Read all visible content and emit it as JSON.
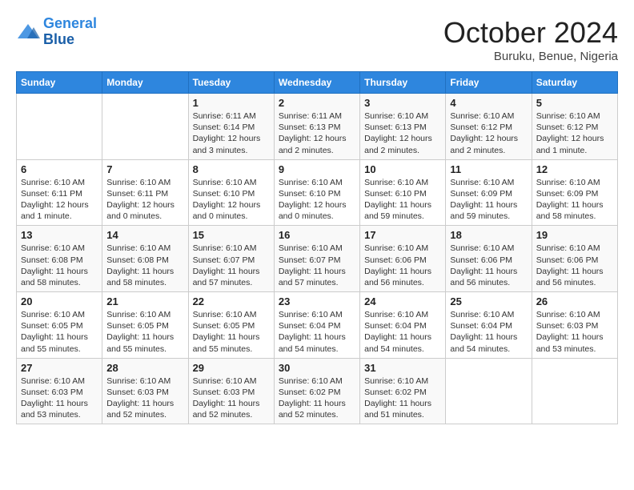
{
  "header": {
    "logo_line1": "General",
    "logo_line2": "Blue",
    "month": "October 2024",
    "location": "Buruku, Benue, Nigeria"
  },
  "weekdays": [
    "Sunday",
    "Monday",
    "Tuesday",
    "Wednesday",
    "Thursday",
    "Friday",
    "Saturday"
  ],
  "weeks": [
    [
      {
        "day": "",
        "info": ""
      },
      {
        "day": "",
        "info": ""
      },
      {
        "day": "1",
        "info": "Sunrise: 6:11 AM\nSunset: 6:14 PM\nDaylight: 12 hours\nand 3 minutes."
      },
      {
        "day": "2",
        "info": "Sunrise: 6:11 AM\nSunset: 6:13 PM\nDaylight: 12 hours\nand 2 minutes."
      },
      {
        "day": "3",
        "info": "Sunrise: 6:10 AM\nSunset: 6:13 PM\nDaylight: 12 hours\nand 2 minutes."
      },
      {
        "day": "4",
        "info": "Sunrise: 6:10 AM\nSunset: 6:12 PM\nDaylight: 12 hours\nand 2 minutes."
      },
      {
        "day": "5",
        "info": "Sunrise: 6:10 AM\nSunset: 6:12 PM\nDaylight: 12 hours\nand 1 minute."
      }
    ],
    [
      {
        "day": "6",
        "info": "Sunrise: 6:10 AM\nSunset: 6:11 PM\nDaylight: 12 hours\nand 1 minute."
      },
      {
        "day": "7",
        "info": "Sunrise: 6:10 AM\nSunset: 6:11 PM\nDaylight: 12 hours\nand 0 minutes."
      },
      {
        "day": "8",
        "info": "Sunrise: 6:10 AM\nSunset: 6:10 PM\nDaylight: 12 hours\nand 0 minutes."
      },
      {
        "day": "9",
        "info": "Sunrise: 6:10 AM\nSunset: 6:10 PM\nDaylight: 12 hours\nand 0 minutes."
      },
      {
        "day": "10",
        "info": "Sunrise: 6:10 AM\nSunset: 6:10 PM\nDaylight: 11 hours\nand 59 minutes."
      },
      {
        "day": "11",
        "info": "Sunrise: 6:10 AM\nSunset: 6:09 PM\nDaylight: 11 hours\nand 59 minutes."
      },
      {
        "day": "12",
        "info": "Sunrise: 6:10 AM\nSunset: 6:09 PM\nDaylight: 11 hours\nand 58 minutes."
      }
    ],
    [
      {
        "day": "13",
        "info": "Sunrise: 6:10 AM\nSunset: 6:08 PM\nDaylight: 11 hours\nand 58 minutes."
      },
      {
        "day": "14",
        "info": "Sunrise: 6:10 AM\nSunset: 6:08 PM\nDaylight: 11 hours\nand 58 minutes."
      },
      {
        "day": "15",
        "info": "Sunrise: 6:10 AM\nSunset: 6:07 PM\nDaylight: 11 hours\nand 57 minutes."
      },
      {
        "day": "16",
        "info": "Sunrise: 6:10 AM\nSunset: 6:07 PM\nDaylight: 11 hours\nand 57 minutes."
      },
      {
        "day": "17",
        "info": "Sunrise: 6:10 AM\nSunset: 6:06 PM\nDaylight: 11 hours\nand 56 minutes."
      },
      {
        "day": "18",
        "info": "Sunrise: 6:10 AM\nSunset: 6:06 PM\nDaylight: 11 hours\nand 56 minutes."
      },
      {
        "day": "19",
        "info": "Sunrise: 6:10 AM\nSunset: 6:06 PM\nDaylight: 11 hours\nand 56 minutes."
      }
    ],
    [
      {
        "day": "20",
        "info": "Sunrise: 6:10 AM\nSunset: 6:05 PM\nDaylight: 11 hours\nand 55 minutes."
      },
      {
        "day": "21",
        "info": "Sunrise: 6:10 AM\nSunset: 6:05 PM\nDaylight: 11 hours\nand 55 minutes."
      },
      {
        "day": "22",
        "info": "Sunrise: 6:10 AM\nSunset: 6:05 PM\nDaylight: 11 hours\nand 55 minutes."
      },
      {
        "day": "23",
        "info": "Sunrise: 6:10 AM\nSunset: 6:04 PM\nDaylight: 11 hours\nand 54 minutes."
      },
      {
        "day": "24",
        "info": "Sunrise: 6:10 AM\nSunset: 6:04 PM\nDaylight: 11 hours\nand 54 minutes."
      },
      {
        "day": "25",
        "info": "Sunrise: 6:10 AM\nSunset: 6:04 PM\nDaylight: 11 hours\nand 54 minutes."
      },
      {
        "day": "26",
        "info": "Sunrise: 6:10 AM\nSunset: 6:03 PM\nDaylight: 11 hours\nand 53 minutes."
      }
    ],
    [
      {
        "day": "27",
        "info": "Sunrise: 6:10 AM\nSunset: 6:03 PM\nDaylight: 11 hours\nand 53 minutes."
      },
      {
        "day": "28",
        "info": "Sunrise: 6:10 AM\nSunset: 6:03 PM\nDaylight: 11 hours\nand 52 minutes."
      },
      {
        "day": "29",
        "info": "Sunrise: 6:10 AM\nSunset: 6:03 PM\nDaylight: 11 hours\nand 52 minutes."
      },
      {
        "day": "30",
        "info": "Sunrise: 6:10 AM\nSunset: 6:02 PM\nDaylight: 11 hours\nand 52 minutes."
      },
      {
        "day": "31",
        "info": "Sunrise: 6:10 AM\nSunset: 6:02 PM\nDaylight: 11 hours\nand 51 minutes."
      },
      {
        "day": "",
        "info": ""
      },
      {
        "day": "",
        "info": ""
      }
    ]
  ]
}
